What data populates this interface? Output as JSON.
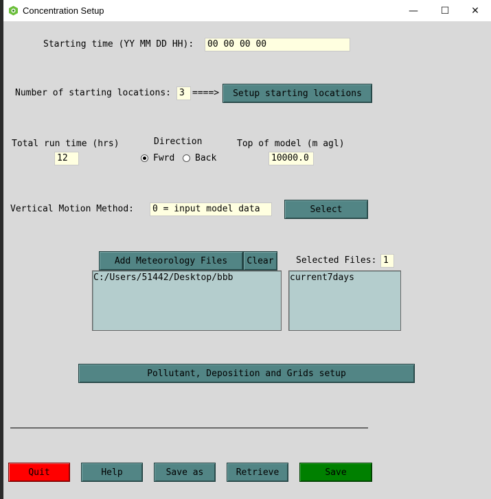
{
  "window": {
    "title": "Concentration Setup",
    "minimize": "—",
    "maximize": "☐",
    "close": "✕"
  },
  "start_time": {
    "label": "Starting time (YY MM DD HH):",
    "value": "00 00 00 00"
  },
  "locations": {
    "label": "Number of starting locations:",
    "value": "3",
    "arrow": "====>",
    "setup_button": "Setup starting locations"
  },
  "run": {
    "total_label": "Total run time (hrs)",
    "total_value": "12",
    "direction_label": "Direction",
    "fwrd": "Fwrd",
    "back": "Back",
    "selected": "Fwrd",
    "top_label": "Top of model (m agl)",
    "top_value": "10000.0"
  },
  "vertical": {
    "label": "Vertical Motion Method:",
    "value": "0 = input model data",
    "select_button": "Select"
  },
  "meteorology": {
    "add_button": "Add Meteorology Files",
    "clear_button": "Clear",
    "selected_label": "Selected Files:",
    "selected_count": "1",
    "dirs": [
      "C:/Users/51442/Desktop/bbb"
    ],
    "files": [
      "current7days"
    ]
  },
  "pollutant_button": "Pollutant, Deposition and Grids setup",
  "bottom": {
    "quit": "Quit",
    "help": "Help",
    "save_as": "Save as",
    "retrieve": "Retrieve",
    "save": "Save"
  },
  "colors": {
    "button": "#528585",
    "entry": "#ffffe0",
    "listbox": "#b4cdcd",
    "quit": "#ff0000",
    "save": "#008000"
  }
}
